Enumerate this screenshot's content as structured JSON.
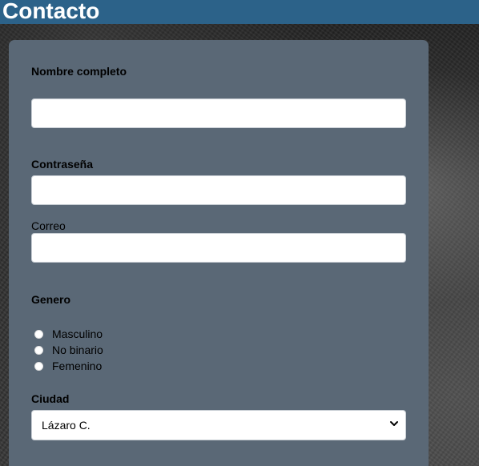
{
  "header": {
    "title": "Contacto",
    "color": "#2c6289"
  },
  "form": {
    "background": "#5a6876",
    "fields": {
      "full_name": {
        "label": "Nombre completo",
        "value": "",
        "placeholder": ""
      },
      "password": {
        "label": "Contraseña",
        "value": "",
        "placeholder": ""
      },
      "email": {
        "label": "Correo",
        "value": "",
        "placeholder": ""
      }
    },
    "gender": {
      "label": "Genero",
      "options": [
        {
          "label": "Masculino",
          "checked": false
        },
        {
          "label": "No binario",
          "checked": false
        },
        {
          "label": "Femenino",
          "checked": false
        }
      ]
    },
    "city": {
      "label": "Ciudad",
      "selected": "Lázaro C.",
      "icon": "chevron-down-icon"
    }
  }
}
